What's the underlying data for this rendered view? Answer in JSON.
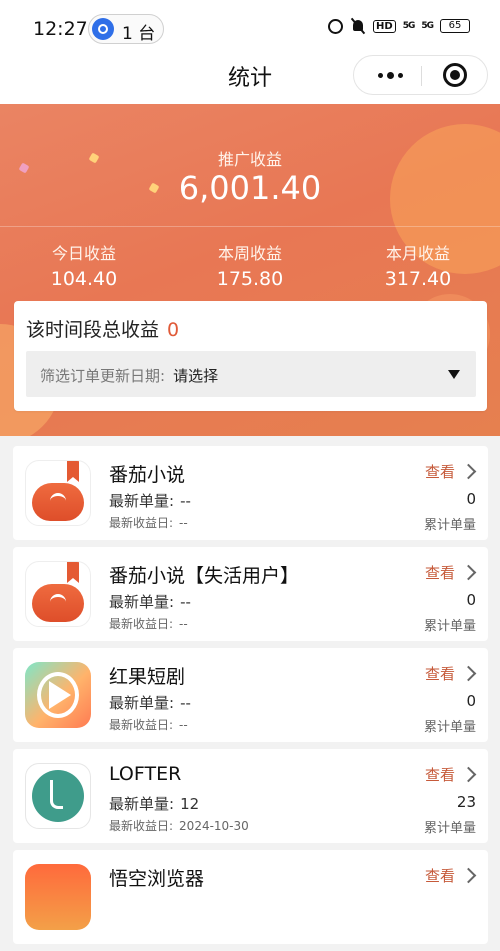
{
  "status_bar": {
    "time": "12:27",
    "pill_text": "1 台",
    "battery": "65",
    "signal_1": "5G",
    "signal_2": "5G",
    "hd_label": "HD"
  },
  "nav": {
    "title": "统计"
  },
  "summary": {
    "promo_label": "推广收益",
    "promo_value": "6,001.40",
    "stats": [
      {
        "label": "今日收益",
        "value": "104.40"
      },
      {
        "label": "本周收益",
        "value": "175.80"
      },
      {
        "label": "本月收益",
        "value": "317.40"
      }
    ]
  },
  "filter": {
    "title": "该时间段总收益",
    "total": "0",
    "select_label": "筛选订单更新日期:",
    "select_value": "请选择"
  },
  "apps": [
    {
      "name": "番茄小说",
      "icon": "tomato-novel-icon",
      "latest_orders_label": "最新单量:",
      "latest_orders": "--",
      "latest_income_label": "最新收益日:",
      "latest_income": "--",
      "view_label": "查看",
      "total": "0",
      "total_label": "累计单量"
    },
    {
      "name": "番茄小说【失活用户】",
      "icon": "tomato-novel-icon",
      "latest_orders_label": "最新单量:",
      "latest_orders": "--",
      "latest_income_label": "最新收益日:",
      "latest_income": "--",
      "view_label": "查看",
      "total": "0",
      "total_label": "累计单量"
    },
    {
      "name": "红果短剧",
      "icon": "hongguo-play-icon",
      "latest_orders_label": "最新单量:",
      "latest_orders": "--",
      "latest_income_label": "最新收益日:",
      "latest_income": "--",
      "view_label": "查看",
      "total": "0",
      "total_label": "累计单量"
    },
    {
      "name": "LOFTER",
      "icon": "lofter-icon",
      "latest_orders_label": "最新单量:",
      "latest_orders": "12",
      "latest_income_label": "最新收益日:",
      "latest_income": "2024-10-30",
      "view_label": "查看",
      "total": "23",
      "total_label": "累计单量"
    },
    {
      "name": "悟空浏览器",
      "icon": "wukong-browser-icon",
      "view_label": "查看"
    }
  ]
}
